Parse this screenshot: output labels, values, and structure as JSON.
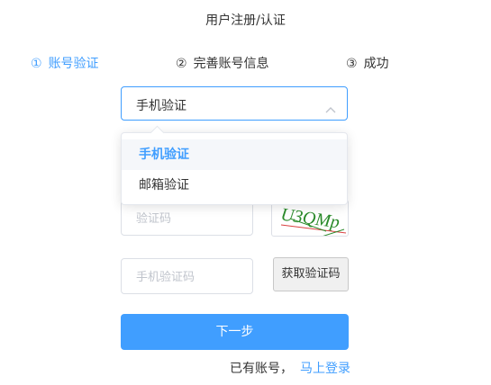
{
  "page": {
    "title": "用户注册/认证"
  },
  "steps": [
    {
      "num": "①",
      "label": "账号验证"
    },
    {
      "num": "②",
      "label": "完善账号信息"
    },
    {
      "num": "③",
      "label": "成功"
    }
  ],
  "verify_method": {
    "selected": "手机验证",
    "options": [
      "手机验证",
      "邮箱验证"
    ]
  },
  "form": {
    "captcha_placeholder": "验证码",
    "captcha_text": "U3QMp",
    "sms_code_placeholder": "手机验证码",
    "get_code_label": "获取验证码",
    "next_label": "下一步"
  },
  "footer": {
    "has_account_text": "已有账号，",
    "login_link": "马上登录"
  },
  "colors": {
    "accent": "#409eff",
    "captcha_text": "#2a8a2a",
    "captcha_line": "#d94040"
  }
}
